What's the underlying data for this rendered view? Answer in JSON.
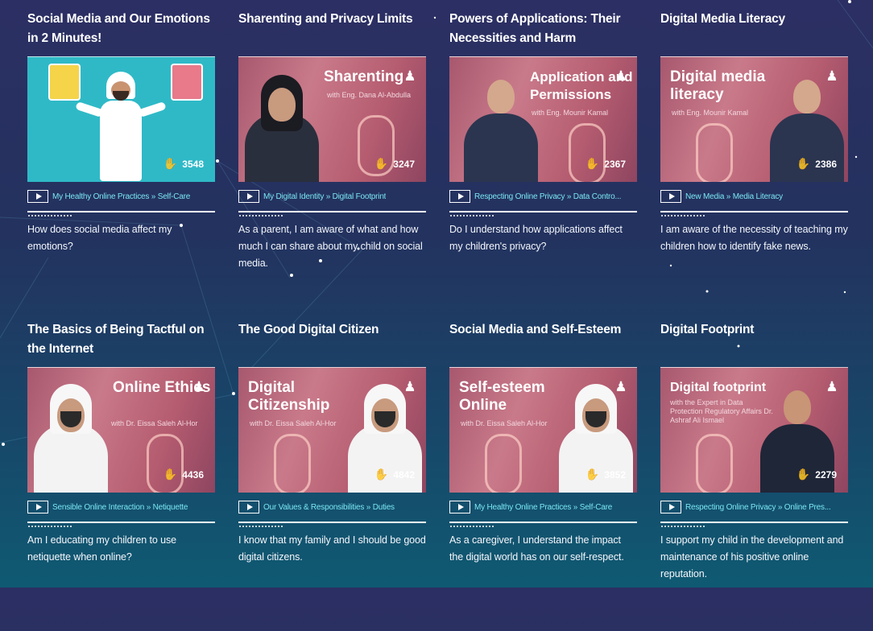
{
  "cards": [
    {
      "title": "Social Media and Our Emotions in 2 Minutes!",
      "views": "3548",
      "category": "My Healthy Online Practices » Self-Care",
      "description": "How does social media affect my emotions?",
      "thumb_style": "cartoon",
      "overlay_title": "",
      "overlay_subtitle": ""
    },
    {
      "title": "Sharenting and Privacy Limits",
      "views": "3247",
      "category": "My Digital Identity » Digital Footprint",
      "description": "As a parent, I am aware of what and how much I can share about my child on social media.",
      "thumb_style": "video",
      "overlay_title": "Sharenting",
      "overlay_subtitle": "with Eng. Dana Al-Abdulla"
    },
    {
      "title": "Powers of Applications: Their Necessities and Harm",
      "views": "2367",
      "category": "Respecting Online Privacy » Data Contro...",
      "description": "Do I understand how applications affect my children's privacy?",
      "thumb_style": "video",
      "overlay_title": "Application and Permissions",
      "overlay_subtitle": "with Eng. Mounir Kamal"
    },
    {
      "title": "Digital Media Literacy",
      "views": "2386",
      "category": "New Media » Media Literacy",
      "description": "I am aware of the necessity of teaching my children how to identify fake news.",
      "thumb_style": "video",
      "overlay_title": "Digital media literacy",
      "overlay_subtitle": "with Eng. Mounir Kamal"
    },
    {
      "title": "The Basics of Being Tactful on the Internet",
      "views": "4436",
      "category": "Sensible Online Interaction » Netiquette",
      "description": "Am I educating my children to use netiquette when online?",
      "thumb_style": "video",
      "overlay_title": "Online Ethics",
      "overlay_subtitle": "with Dr. Eissa Saleh Al-Hor"
    },
    {
      "title": "The Good Digital Citizen",
      "views": "4842",
      "category": "Our Values & Responsibilities » Duties",
      "description": "I know that my family and I should be good digital citizens.",
      "thumb_style": "video",
      "overlay_title": "Digital Citizenship",
      "overlay_subtitle": "with Dr. Eissa Saleh Al-Hor"
    },
    {
      "title": "Social Media and Self-Esteem",
      "views": "3852",
      "category": "My Healthy Online Practices » Self-Care",
      "description": "As a caregiver, I understand the impact the digital world has on our self-respect.",
      "thumb_style": "video",
      "overlay_title": "Self-esteem Online",
      "overlay_subtitle": "with Dr. Eissa Saleh Al-Hor"
    },
    {
      "title": "Digital Footprint",
      "views": "2279",
      "category": "Respecting Online Privacy » Online Pres...",
      "description": "I support my child in the development and maintenance of his positive online reputation.",
      "thumb_style": "video",
      "overlay_title": "Digital footprint",
      "overlay_subtitle": "with the Expert in Data Protection Regulatory Affairs Dr. Ashraf Ali Ismael"
    }
  ],
  "colors": {
    "category_text": "#79e6f2",
    "background_top": "#2c2f63",
    "background_bottom": "#0f5a72"
  }
}
